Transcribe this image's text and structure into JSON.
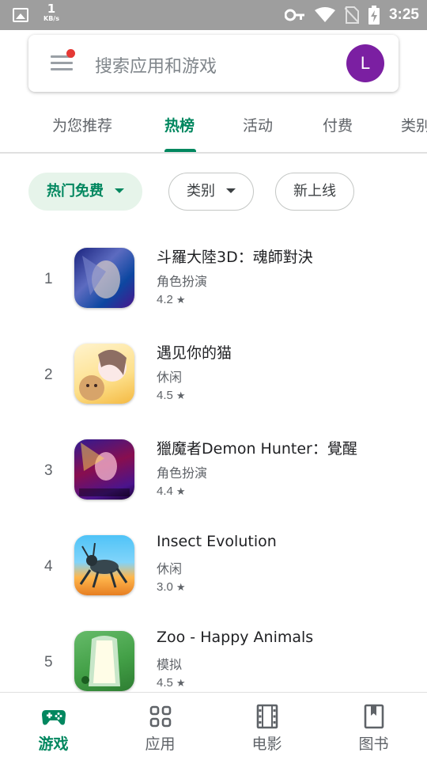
{
  "status_bar": {
    "net_speed_value": "1",
    "net_speed_unit": "KB/s",
    "time": "3:25",
    "icons": [
      "image-icon",
      "key-icon",
      "wifi-icon",
      "no-sim-icon",
      "battery-charging-icon"
    ]
  },
  "search": {
    "placeholder": "搜索应用和游戏",
    "avatar_letter": "L",
    "avatar_color": "#7b1fa2"
  },
  "tabs": [
    {
      "label": "为您推荐",
      "active": false
    },
    {
      "label": "热榜",
      "active": true
    },
    {
      "label": "活动",
      "active": false
    },
    {
      "label": "付费",
      "active": false
    },
    {
      "label": "类别",
      "active": false
    }
  ],
  "chips": [
    {
      "label": "热门免费",
      "selected": true,
      "dropdown": true
    },
    {
      "label": "类别",
      "selected": false,
      "dropdown": true
    },
    {
      "label": "新上线",
      "selected": false,
      "dropdown": false
    }
  ],
  "apps": [
    {
      "rank": "1",
      "name": "斗羅大陸3D：魂師對決",
      "category": "角色扮演",
      "rating": "4.2"
    },
    {
      "rank": "2",
      "name": "遇见你的猫",
      "category": "休闲",
      "rating": "4.5"
    },
    {
      "rank": "3",
      "name": "獵魔者Demon Hunter：覺醒",
      "category": "角色扮演",
      "rating": "4.4"
    },
    {
      "rank": "4",
      "name": "Insect Evolution",
      "category": "休闲",
      "rating": "3.0"
    },
    {
      "rank": "5",
      "name": "Zoo - Happy Animals",
      "category": "模拟",
      "rating": "4.5"
    }
  ],
  "rating_star": "★",
  "bottom_nav": [
    {
      "label": "游戏",
      "icon": "gamepad-icon",
      "active": true
    },
    {
      "label": "应用",
      "icon": "apps-grid-icon",
      "active": false
    },
    {
      "label": "电影",
      "icon": "film-icon",
      "active": false
    },
    {
      "label": "图书",
      "icon": "book-icon",
      "active": false
    }
  ],
  "colors": {
    "accent": "#01875f",
    "chip_selected_bg": "#e6f4ea",
    "status_bar_bg": "#9e9e9e"
  }
}
